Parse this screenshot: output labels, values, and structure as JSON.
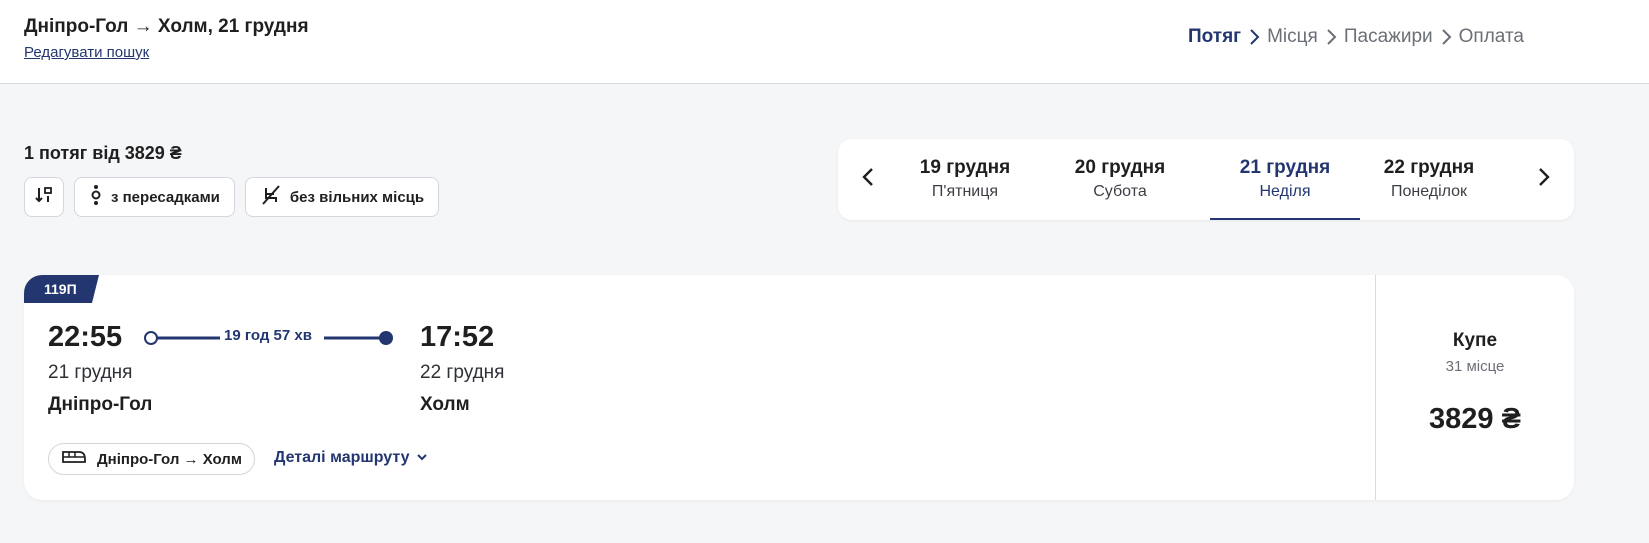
{
  "header": {
    "route_title": "Дніпро-Гол → Холм, 21 грудня",
    "edit_link": "Редагувати пошук",
    "steps": [
      {
        "label": "Потяг",
        "active": true
      },
      {
        "label": "Місця",
        "active": false
      },
      {
        "label": "Пасажири",
        "active": false
      },
      {
        "label": "Оплата",
        "active": false
      }
    ]
  },
  "summary": "1 потяг від 3829 ₴",
  "filters": {
    "sort_icon": "sort-icon",
    "transfers_label": "з пересадками",
    "no_seats_label": "без вільних місць"
  },
  "dates": [
    {
      "date": "19 грудня",
      "weekday": "П'ятниця",
      "active": false
    },
    {
      "date": "20 грудня",
      "weekday": "Субота",
      "active": false
    },
    {
      "date": "21 грудня",
      "weekday": "Неділя",
      "active": true
    },
    {
      "date": "22 грудня",
      "weekday": "Понеділок",
      "active": false
    }
  ],
  "train": {
    "number": "119П",
    "departure_time": "22:55",
    "departure_date": "21 грудня",
    "departure_station": "Дніпро-Гол",
    "duration": "19 год 57 хв",
    "arrival_time": "17:52",
    "arrival_date": "22 грудня",
    "arrival_station": "Холм",
    "route": "Дніпро-Гол → Холм",
    "details_link": "Деталі маршруту",
    "class_name": "Купе",
    "seats": "31 місце",
    "price": "3829 ₴"
  },
  "colors": {
    "accent": "#23366f",
    "background": "#f5f6f8"
  }
}
